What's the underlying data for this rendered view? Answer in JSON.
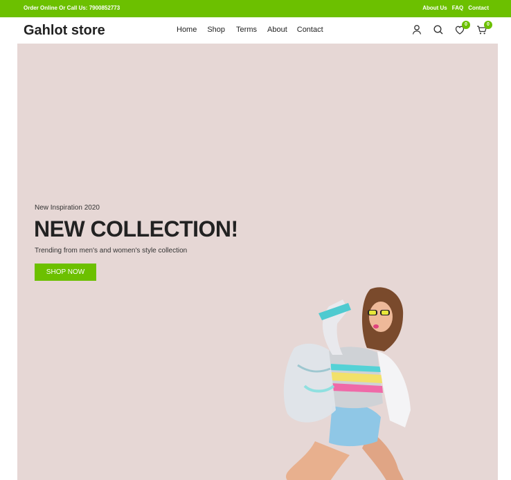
{
  "topbar": {
    "contact_text": "Order Online Or Call Us: 7900852773",
    "links": [
      "About Us",
      "FAQ",
      "Contact"
    ]
  },
  "header": {
    "logo": "Gahlot store",
    "nav": [
      "Home",
      "Shop",
      "Terms",
      "About",
      "Contact"
    ],
    "icons": [
      "user-icon",
      "search-icon",
      "heart-icon",
      "cart-icon"
    ],
    "wishlist_count": "0",
    "cart_count": "0"
  },
  "hero": {
    "eyebrow": "New Inspiration 2020",
    "headline": "NEW COLLECTION!",
    "subtitle": "Trending from men's and women's style collection",
    "cta_label": "SHOP NOW"
  },
  "colors": {
    "accent": "#6cc000",
    "hero_bg": "#e6d7d5",
    "text": "#222222"
  }
}
